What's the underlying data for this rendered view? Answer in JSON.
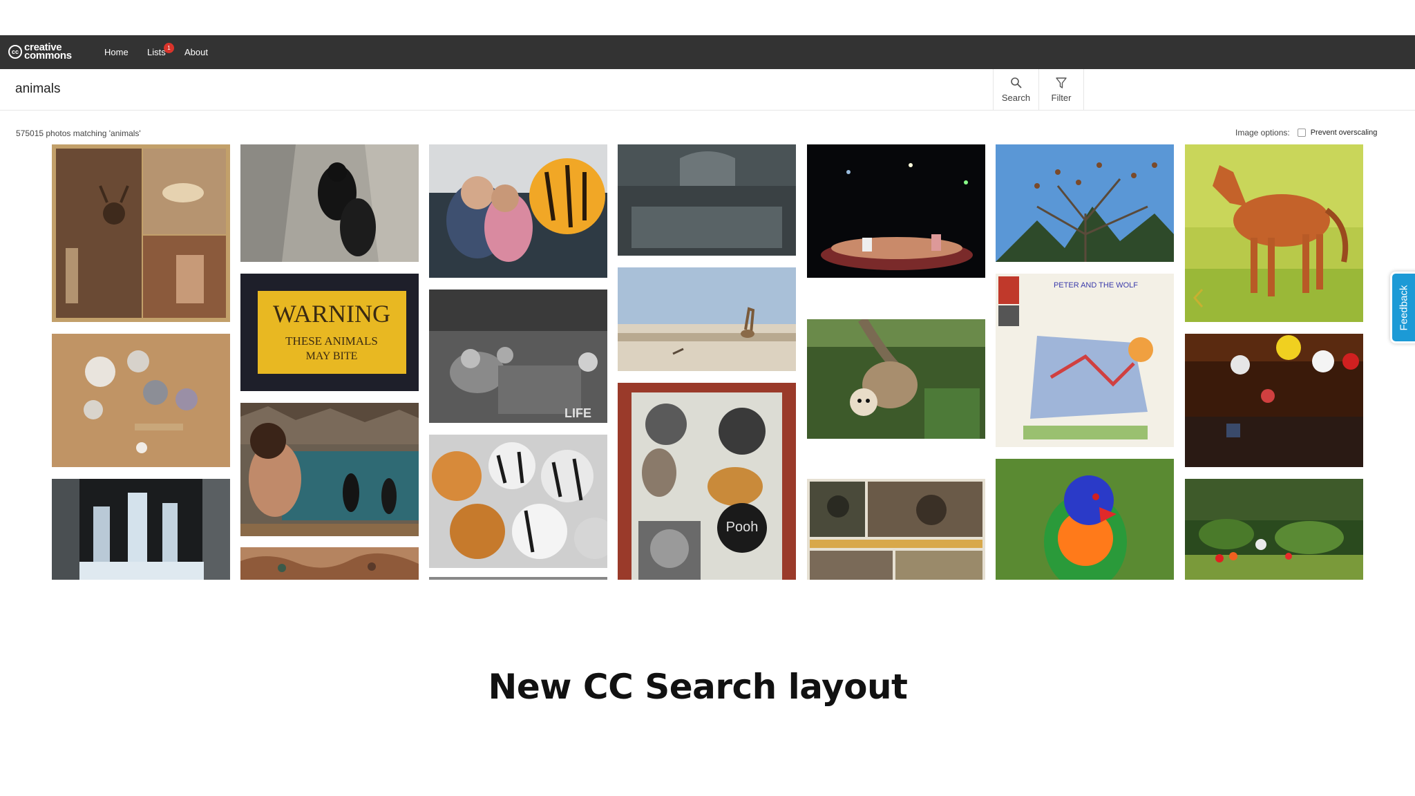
{
  "navbar": {
    "logo_text_top": "creative",
    "logo_text_bottom": "commons",
    "logo_mark": "cc",
    "links": [
      "Home",
      "Lists",
      "About"
    ],
    "lists_badge": "1"
  },
  "search": {
    "query": "animals",
    "search_label": "Search",
    "filter_label": "Filter"
  },
  "results": {
    "count_text": "575015 photos matching 'animals'",
    "image_options_label": "Image options:",
    "prevent_overscaling_label": "Prevent overscaling",
    "prevent_overscaling_checked": false
  },
  "tiles": [
    {
      "name": "photo-deer-collage",
      "text": ""
    },
    {
      "name": "photo-black-bears",
      "text": ""
    },
    {
      "name": "photo-tiger-balloon",
      "text": ""
    },
    {
      "name": "photo-coat-of-arms",
      "text": ""
    },
    {
      "name": "photo-circus-night",
      "text": ""
    },
    {
      "name": "photo-birds-in-tree",
      "text": ""
    },
    {
      "name": "photo-foal",
      "text": ""
    },
    {
      "name": "photo-figurines",
      "text": ""
    },
    {
      "name": "photo-warning-sign",
      "text": "WARNING"
    },
    {
      "name": "photo-vintage-bw",
      "text": "LIFE"
    },
    {
      "name": "photo-giraffe-plain",
      "text": ""
    },
    {
      "name": "photo-sloth",
      "text": ""
    },
    {
      "name": "photo-peter-wolf-album",
      "text": "PETER AND THE WOLF"
    },
    {
      "name": "photo-hanging-toys",
      "text": ""
    },
    {
      "name": "photo-ice-sculpture",
      "text": ""
    },
    {
      "name": "photo-penguin-tank",
      "text": ""
    },
    {
      "name": "photo-plush-tigers",
      "text": ""
    },
    {
      "name": "photo-mosaic-wall",
      "text": "Pooh"
    },
    {
      "name": "photo-monkey-postcard",
      "text": ""
    },
    {
      "name": "photo-lorikeet",
      "text": ""
    },
    {
      "name": "photo-flower-garden",
      "text": ""
    },
    {
      "name": "photo-painted-mural",
      "text": ""
    }
  ],
  "warning_sign": {
    "line1": "WARNING",
    "line2": "THESE ANIMALS",
    "line3": "MAY BITE"
  },
  "feedback_label": "Feedback",
  "caption": "New CC Search layout"
}
